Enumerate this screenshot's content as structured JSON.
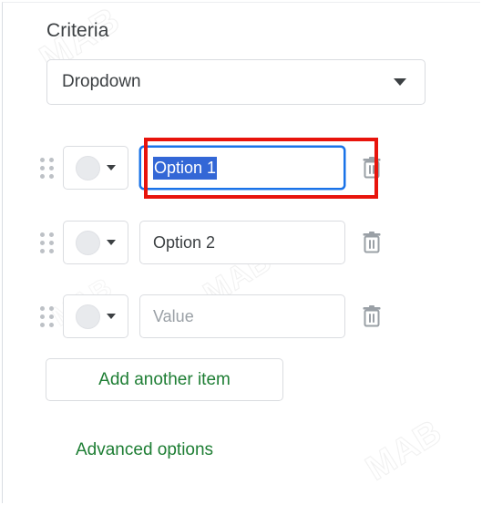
{
  "section": {
    "label": "Criteria"
  },
  "type_select": {
    "value": "Dropdown",
    "caret_icon": "chevron-down-icon"
  },
  "rows": [
    {
      "drag_icon": "drag-handle-icon",
      "swatch_icon": "color-circle-icon",
      "swatch_caret_icon": "chevron-down-icon",
      "value": "Option 1",
      "placeholder": "Value",
      "is_placeholder": false,
      "focused": true,
      "text_selected": true,
      "delete_icon": "trash-icon"
    },
    {
      "drag_icon": "drag-handle-icon",
      "swatch_icon": "color-circle-icon",
      "swatch_caret_icon": "chevron-down-icon",
      "value": "Option 2",
      "placeholder": "Value",
      "is_placeholder": false,
      "focused": false,
      "text_selected": false,
      "delete_icon": "trash-icon"
    },
    {
      "drag_icon": "drag-handle-icon",
      "swatch_icon": "color-circle-icon",
      "swatch_caret_icon": "chevron-down-icon",
      "value": "Value",
      "placeholder": "Value",
      "is_placeholder": true,
      "focused": false,
      "text_selected": false,
      "delete_icon": "trash-icon"
    }
  ],
  "actions": {
    "add_item_label": "Add another item",
    "advanced_options_label": "Advanced options"
  },
  "watermark": {
    "text": "MAB"
  },
  "colors": {
    "accent_green": "#1e7e34",
    "focus_blue": "#1a73e8",
    "selection_blue": "#3367d6",
    "annotation_red": "#e8140c",
    "text_primary": "#3c4043",
    "text_placeholder": "#9aa0a6",
    "border_gray": "#dadce0"
  }
}
